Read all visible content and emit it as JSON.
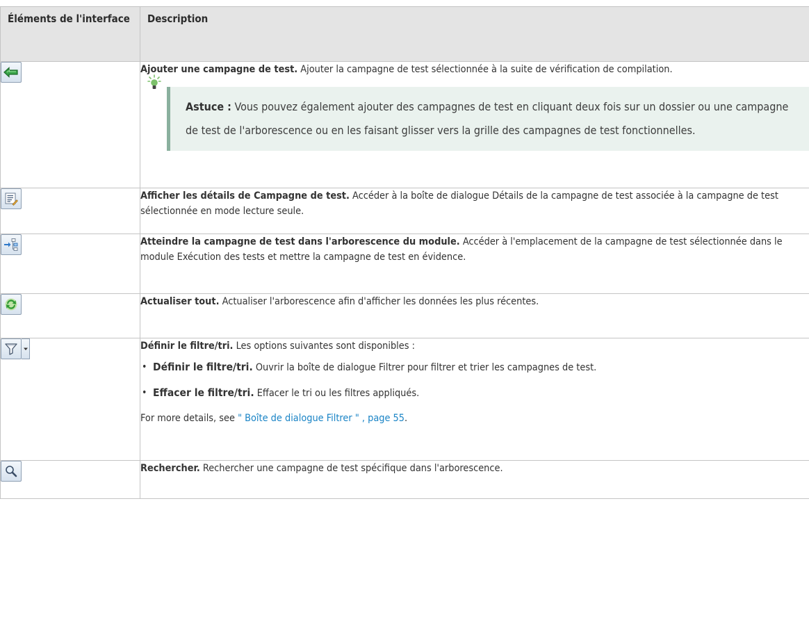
{
  "header": {
    "col1": "Éléments de l'interface",
    "col2": "Description"
  },
  "rows": [
    {
      "icon": "add-arrow-icon",
      "title": "Ajouter une campagne de test.",
      "text": " Ajouter la campagne de test sélectionnée à la suite de vérification de compilation.",
      "tip_label": "Astuce :",
      "tip_text": " Vous pouvez également ajouter des campagnes de test en cliquant deux fois sur un dossier ou une campagne de test de l'arborescence ou en les faisant glisser vers la grille des campagnes de test fonctionnelles."
    },
    {
      "icon": "details-icon",
      "title": "Afficher les détails de Campagne de test.",
      "text": " Accéder à la boîte de dialogue Détails de la campagne de test associée à la campagne de test sélectionnée en mode lecture seule."
    },
    {
      "icon": "goto-tree-icon",
      "title": "Atteindre la campagne de test dans l'arborescence du module.",
      "text": " Accéder à l'emplacement de la campagne de test sélectionnée dans le module Exécution des tests et mettre la campagne de test en évidence."
    },
    {
      "icon": "refresh-icon",
      "title": "Actualiser tout.",
      "text": " Actualiser l'arborescence afin d'afficher les données les plus récentes."
    },
    {
      "icon": "filter-icon",
      "title": "Définir le filtre/tri.",
      "text": " Les options suivantes sont disponibles :",
      "options": [
        {
          "title": "Définir le filtre/tri.",
          "text": " Ouvrir la boîte de dialogue Filtrer pour filtrer et trier les campagnes de test."
        },
        {
          "title": "Effacer le filtre/tri.",
          "text": " Effacer le tri ou les filtres appliqués."
        }
      ],
      "more_prefix": "For more details, see ",
      "more_link": "\" Boîte de dialogue Filtrer \" , page 55",
      "more_suffix": "."
    },
    {
      "icon": "search-icon",
      "title": "Rechercher.",
      "text": " Rechercher une campagne de test spécifique dans l'arborescence."
    }
  ],
  "colors": {
    "header_bg": "#e4e4e4",
    "tip_bg": "#eaf2ee",
    "tip_border": "#8ab09e",
    "link": "#1a84c6"
  }
}
